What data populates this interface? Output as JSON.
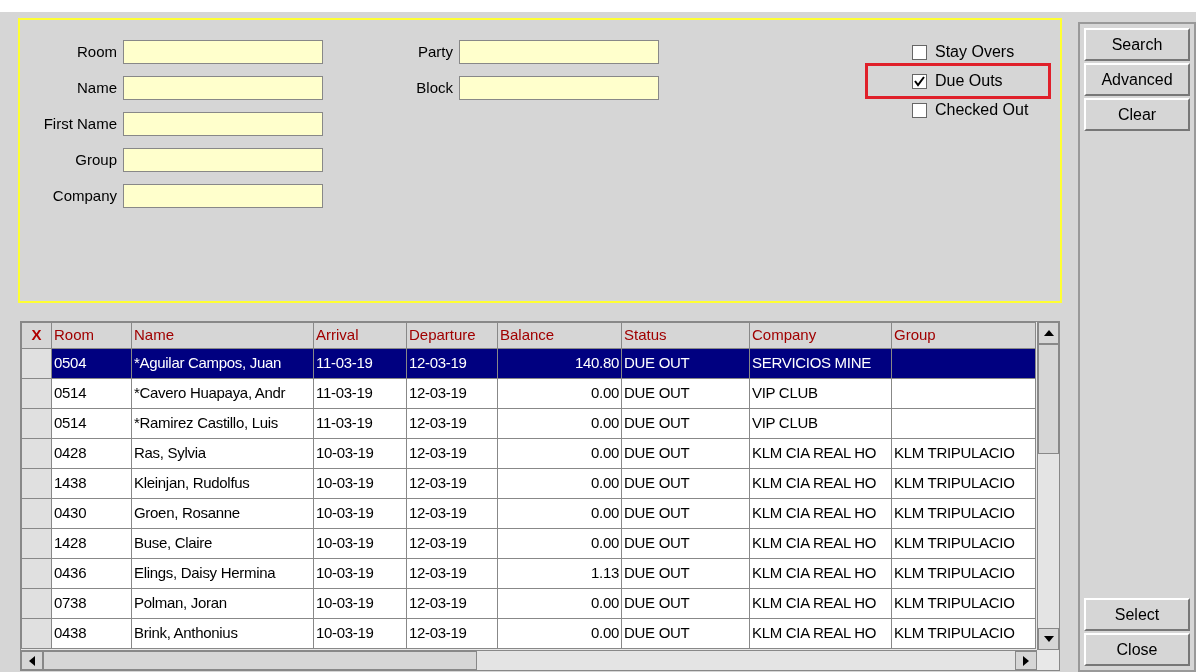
{
  "search_fields": [
    {
      "label": "Room"
    },
    {
      "label": "Name"
    },
    {
      "label": "First Name"
    },
    {
      "label": "Group"
    },
    {
      "label": "Company"
    }
  ],
  "search_fields_2": [
    {
      "label": "Party"
    },
    {
      "label": "Block"
    }
  ],
  "filters": [
    {
      "label": "Stay Overs",
      "checked": false,
      "highlighted": false
    },
    {
      "label": "Due Outs",
      "checked": true,
      "highlighted": true
    },
    {
      "label": "Checked Out",
      "checked": false,
      "highlighted": false
    }
  ],
  "table": {
    "marker": "X",
    "columns": [
      "Room",
      "Name",
      "Arrival",
      "Departure",
      "Balance",
      "Status",
      "Company",
      "Group"
    ],
    "rows": [
      {
        "selected": true,
        "cells": [
          "0504",
          "*Aguilar Campos, Juan",
          "11-03-19",
          "12-03-19",
          "140.80",
          "DUE OUT",
          "SERVICIOS MINE",
          ""
        ]
      },
      {
        "selected": false,
        "cells": [
          "0514",
          "*Cavero Huapaya, Andr",
          "11-03-19",
          "12-03-19",
          "0.00",
          "DUE OUT",
          "VIP CLUB",
          ""
        ]
      },
      {
        "selected": false,
        "cells": [
          "0514",
          "*Ramirez Castillo, Luis",
          "11-03-19",
          "12-03-19",
          "0.00",
          "DUE OUT",
          "VIP CLUB",
          ""
        ]
      },
      {
        "selected": false,
        "cells": [
          "0428",
          "Ras, Sylvia",
          "10-03-19",
          "12-03-19",
          "0.00",
          "DUE OUT",
          "KLM CIA REAL HO",
          "KLM TRIPULACIO"
        ]
      },
      {
        "selected": false,
        "cells": [
          "1438",
          "Kleinjan, Rudolfus",
          "10-03-19",
          "12-03-19",
          "0.00",
          "DUE OUT",
          "KLM CIA REAL HO",
          "KLM TRIPULACIO"
        ]
      },
      {
        "selected": false,
        "cells": [
          "0430",
          "Groen, Rosanne",
          "10-03-19",
          "12-03-19",
          "0.00",
          "DUE OUT",
          "KLM CIA REAL HO",
          "KLM TRIPULACIO"
        ]
      },
      {
        "selected": false,
        "cells": [
          "1428",
          "Buse, Claire",
          "10-03-19",
          "12-03-19",
          "0.00",
          "DUE OUT",
          "KLM CIA REAL HO",
          "KLM TRIPULACIO"
        ]
      },
      {
        "selected": false,
        "cells": [
          "0436",
          "Elings, Daisy Hermina",
          "10-03-19",
          "12-03-19",
          "1.13",
          "DUE OUT",
          "KLM CIA REAL HO",
          "KLM TRIPULACIO"
        ]
      },
      {
        "selected": false,
        "cells": [
          "0738",
          "Polman, Joran",
          "10-03-19",
          "12-03-19",
          "0.00",
          "DUE OUT",
          "KLM CIA REAL HO",
          "KLM TRIPULACIO"
        ]
      },
      {
        "selected": false,
        "cells": [
          "0438",
          "Brink, Anthonius",
          "10-03-19",
          "12-03-19",
          "0.00",
          "DUE OUT",
          "KLM CIA REAL HO",
          "KLM TRIPULACIO"
        ]
      }
    ]
  },
  "buttons_top": [
    "Search",
    "Advanced",
    "Clear"
  ],
  "buttons_bottom": [
    "Select",
    "Close"
  ]
}
